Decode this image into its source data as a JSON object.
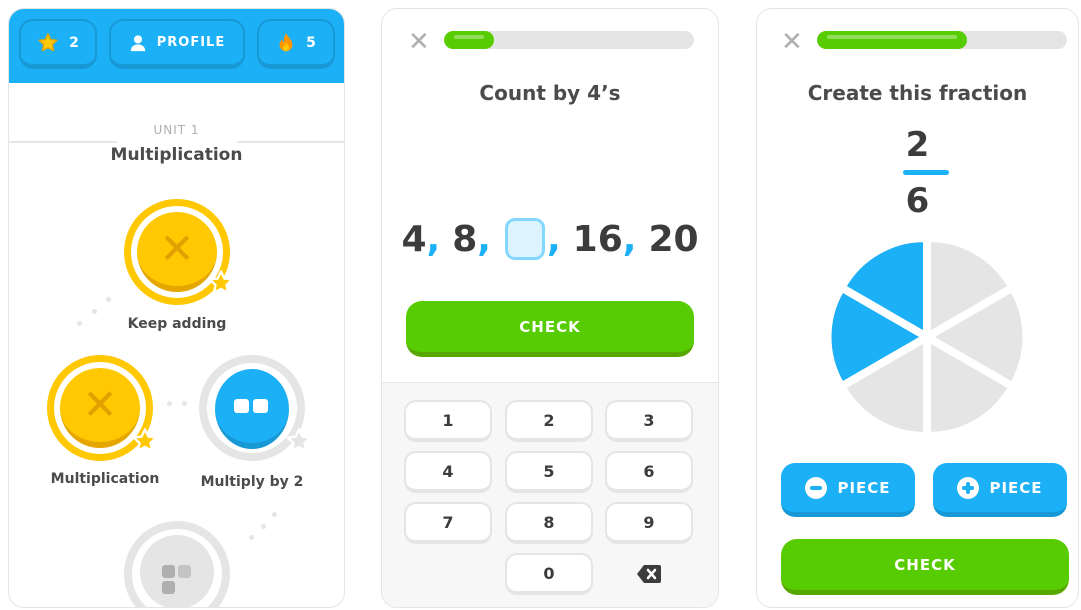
{
  "learn_screen": {
    "xp_count": "2",
    "profile_label": "PROFILE",
    "streak_count": "5",
    "unit_label": "UNIT 1",
    "unit_title": "Multiplication",
    "lessons": [
      {
        "label": "Keep adding",
        "state": "completed"
      },
      {
        "label": "Multiplication",
        "state": "completed"
      },
      {
        "label": "Multiply by 2",
        "state": "current"
      },
      {
        "label": "",
        "state": "locked"
      }
    ]
  },
  "count_exercise": {
    "close_icon": "close-icon",
    "progress_fraction": 0.2,
    "prompt": "Count by 4’s",
    "sequence": [
      "4",
      "8",
      "",
      "16",
      "20"
    ],
    "check_label": "CHECK",
    "keypad": [
      "1",
      "2",
      "3",
      "4",
      "5",
      "6",
      "7",
      "8",
      "9",
      "0"
    ]
  },
  "fraction_exercise": {
    "close_icon": "close-icon",
    "progress_fraction": 0.6,
    "prompt": "Create this fraction",
    "numerator": "2",
    "denominator": "6",
    "total_pieces": 6,
    "filled_pieces": 2,
    "minus_piece_label": "PIECE",
    "plus_piece_label": "PIECE",
    "check_label": "CHECK"
  },
  "colors": {
    "brand_blue": "#1cb0f6",
    "brand_green": "#58cc02",
    "gold": "#ffc800",
    "grey": "#e5e5e5"
  }
}
